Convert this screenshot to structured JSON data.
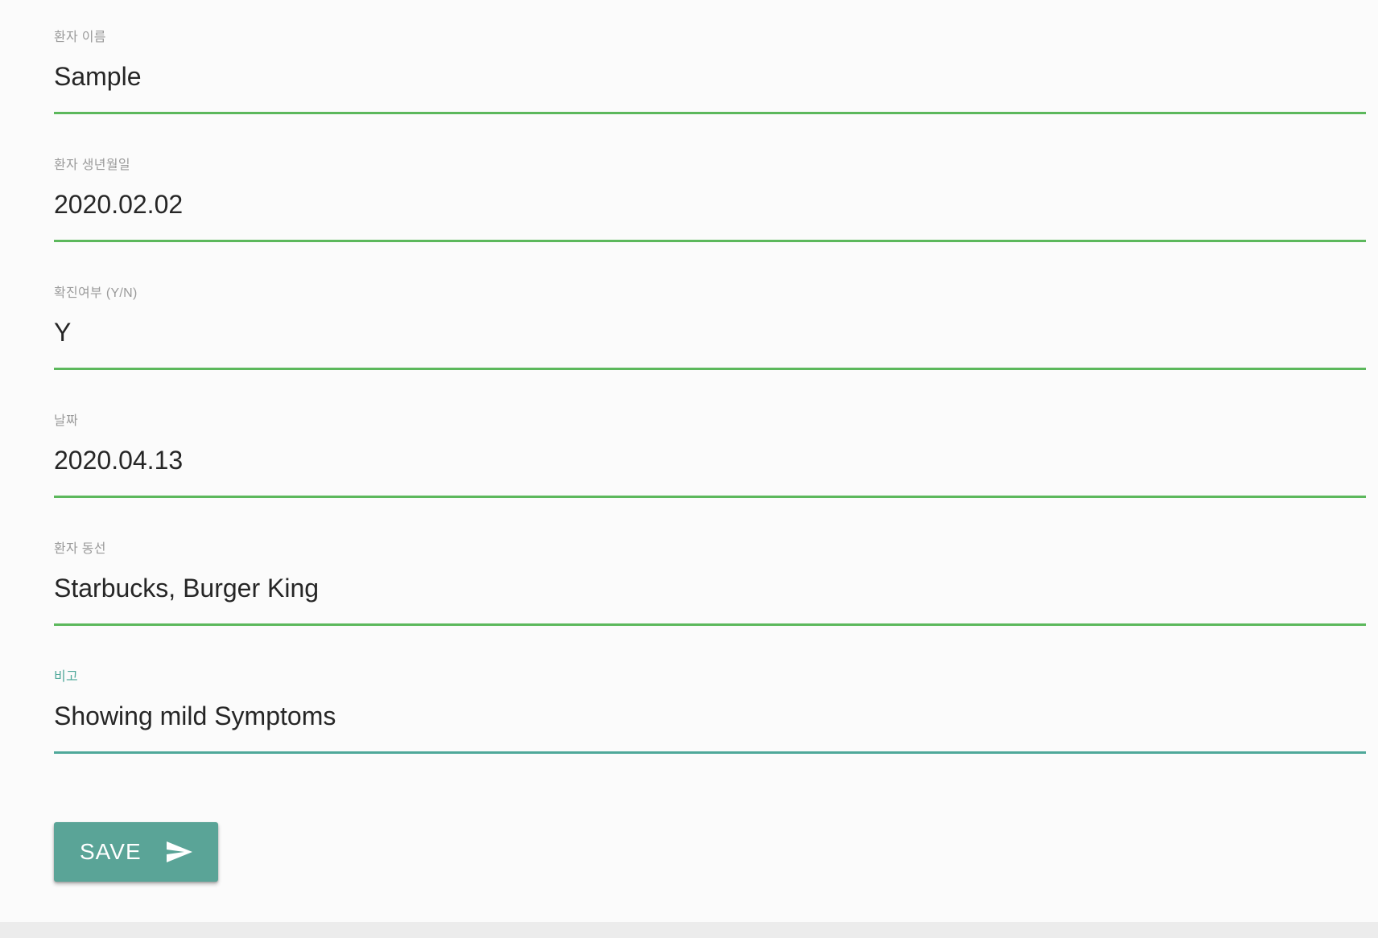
{
  "form": {
    "fields": [
      {
        "label": "환자 이름",
        "value": "Sample"
      },
      {
        "label": "환자 생년월일",
        "value": "2020.02.02"
      },
      {
        "label": "확진여부 (Y/N)",
        "value": "Y"
      },
      {
        "label": "날짜",
        "value": "2020.04.13"
      },
      {
        "label": "환자 동선",
        "value": "Starbucks, Burger King"
      },
      {
        "label": "비고",
        "value": "Showing mild Symptoms"
      }
    ],
    "focused_field_index": 5
  },
  "save_button": {
    "label": "SAVE",
    "icon": "send-icon"
  },
  "colors": {
    "underline": "#5cb85c",
    "focus_accent": "#4fa89a",
    "button_bg": "#5aa497",
    "page_bg": "#fbfbfb"
  }
}
